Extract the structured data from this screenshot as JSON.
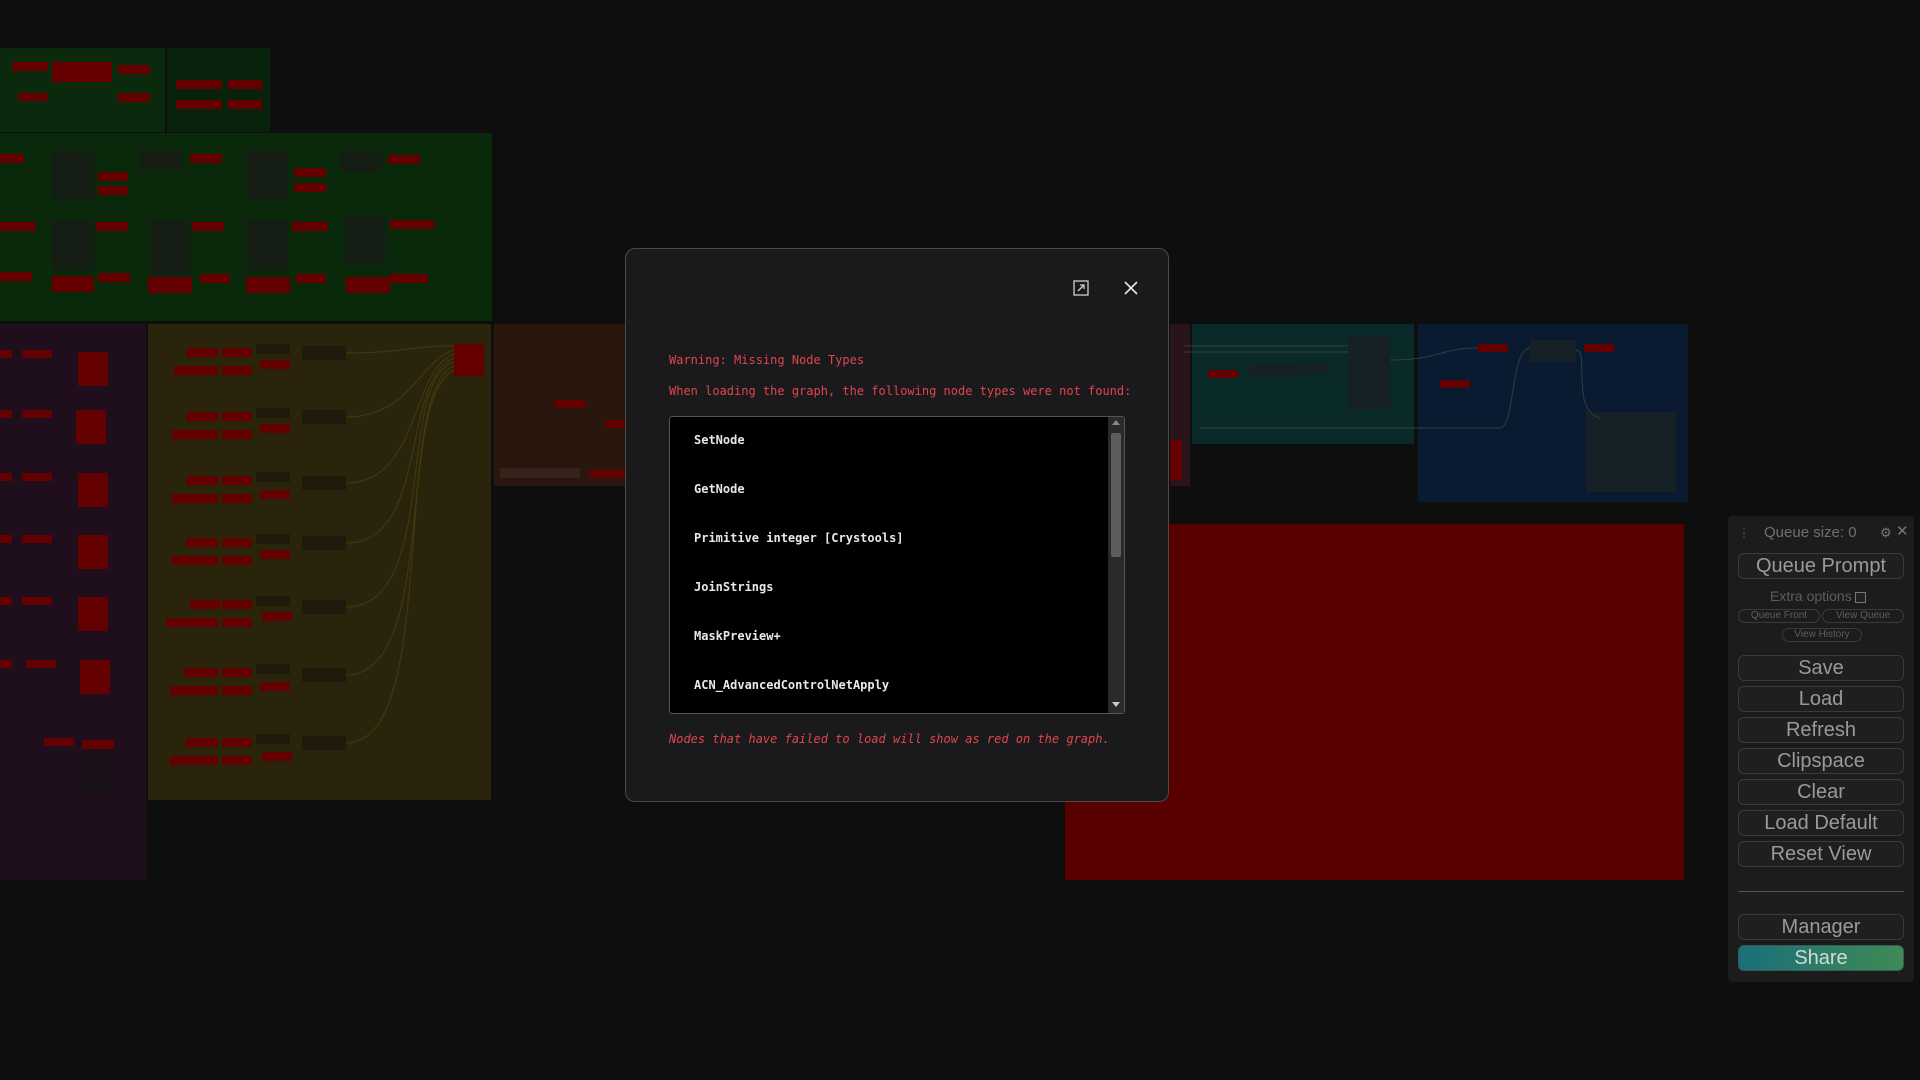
{
  "canvas": {
    "background": "#141414",
    "missing_node_color": "#8b0000"
  },
  "dialog": {
    "title": "Warning: Missing Node Types",
    "description": "When loading the graph, the following node types were not found:",
    "missing_nodes": [
      "SetNode",
      "GetNode",
      "Primitive integer [Crystools]",
      "JoinStrings",
      "MaskPreview+",
      "ACN_AdvancedControlNetApply"
    ],
    "footer": "Nodes that have failed to load will show as red on the graph.",
    "text_color": "#e0454c",
    "expand_icon": "expand-icon",
    "close_icon": "close-icon"
  },
  "side_menu": {
    "queue_size_label": "Queue size: 0",
    "queue_prompt": "Queue Prompt",
    "extra_options": "Extra options",
    "queue_front": "Queue Front",
    "view_queue": "View Queue",
    "view_history": "View History",
    "save": "Save",
    "load": "Load",
    "refresh": "Refresh",
    "clipspace": "Clipspace",
    "clear": "Clear",
    "load_default": "Load Default",
    "reset_view": "Reset View",
    "manager": "Manager",
    "share": "Share",
    "drag_icon": "drag-handle-icon",
    "gear_icon": "gear-icon",
    "close_icon": "close-icon"
  }
}
